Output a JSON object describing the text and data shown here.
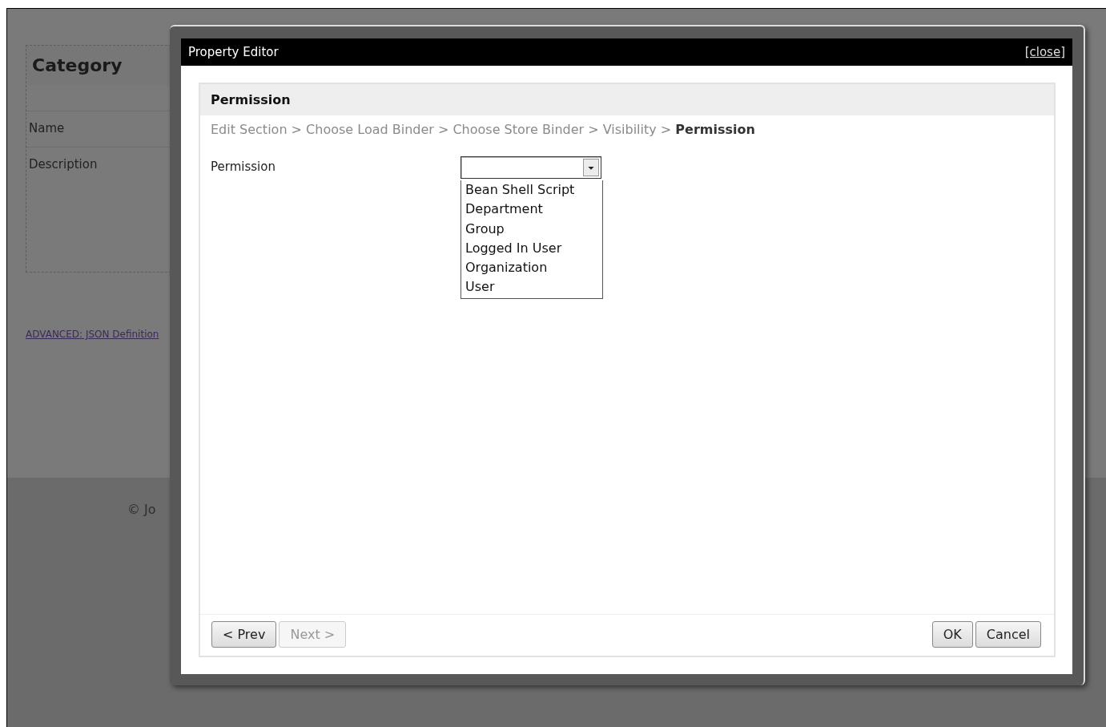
{
  "background": {
    "form_title": "Category",
    "fields": [
      "Name",
      "Description"
    ],
    "link": "ADVANCED: JSON Definition",
    "footer": "© Jo"
  },
  "dialog": {
    "title": "Property Editor",
    "close": "[close]",
    "section_title": "Permission",
    "breadcrumb": "Edit Section > Choose Load Binder > Choose Store Binder > Visibility > **Permission**",
    "field_label": "Permission",
    "dropdown": {
      "expanded": true,
      "options": [
        "Bean Shell Script",
        "Department",
        "Group",
        "Logged In User",
        "Organization",
        "User"
      ]
    },
    "nav_buttons": [
      {
        "label": "< Prev",
        "disabled": false
      },
      {
        "label": "Next >",
        "disabled": true
      }
    ],
    "action_buttons": [
      {
        "label": "OK",
        "disabled": false
      },
      {
        "label": "Cancel",
        "disabled": false
      }
    ]
  }
}
